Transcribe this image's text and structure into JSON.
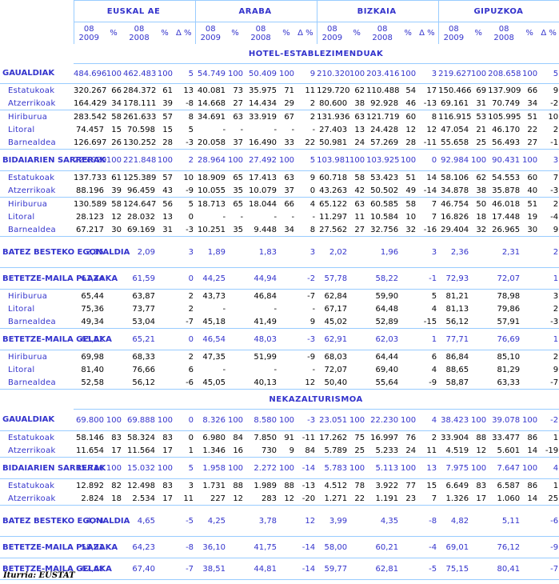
{
  "header": {
    "groups": [
      "EUSKAL AE",
      "ARABA",
      "BIZKAIA",
      "GIPUZKOA"
    ],
    "columns": [
      {
        "line1": "08",
        "line2": "2009"
      },
      {
        "line1": "%",
        "line2": ""
      },
      {
        "line1": "08",
        "line2": "2008"
      },
      {
        "line1": "%",
        "line2": ""
      },
      {
        "line1": "Δ %",
        "line2": ""
      }
    ]
  },
  "sections": [
    {
      "title": "HOTEL-ESTABLEZIMENDUAK",
      "blocks": [
        {
          "rows": [
            {
              "kind": "main",
              "label": "GAUALDIAK",
              "values": [
                "484.696",
                "100",
                "462.483",
                "100",
                "5",
                "54.749",
                "100",
                "50.409",
                "100",
                "9",
                "210.320",
                "100",
                "203.416",
                "100",
                "3",
                "219.627",
                "100",
                "208.658",
                "100",
                "5"
              ]
            }
          ]
        },
        {
          "rows": [
            {
              "kind": "sub",
              "label": "Estatukoak",
              "values": [
                "320.267",
                "66",
                "284.372",
                "61",
                "13",
                "40.081",
                "73",
                "35.975",
                "71",
                "11",
                "129.720",
                "62",
                "110.488",
                "54",
                "17",
                "150.466",
                "69",
                "137.909",
                "66",
                "9"
              ]
            },
            {
              "kind": "sub",
              "label": "Atzerrikoak",
              "values": [
                "164.429",
                "34",
                "178.111",
                "39",
                "-8",
                "14.668",
                "27",
                "14.434",
                "29",
                "2",
                "80.600",
                "38",
                "92.928",
                "46",
                "-13",
                "69.161",
                "31",
                "70.749",
                "34",
                "-2"
              ]
            }
          ]
        },
        {
          "rows": [
            {
              "kind": "sub",
              "label": "Hiriburua",
              "values": [
                "283.542",
                "58",
                "261.633",
                "57",
                "8",
                "34.691",
                "63",
                "33.919",
                "67",
                "2",
                "131.936",
                "63",
                "121.719",
                "60",
                "8",
                "116.915",
                "53",
                "105.995",
                "51",
                "10"
              ]
            },
            {
              "kind": "sub",
              "label": "Litoral",
              "values": [
                "74.457",
                "15",
                "70.598",
                "15",
                "5",
                "-",
                "-",
                "-",
                "-",
                "-",
                "27.403",
                "13",
                "24.428",
                "12",
                "12",
                "47.054",
                "21",
                "46.170",
                "22",
                "2"
              ]
            },
            {
              "kind": "sub",
              "label": "Barnealdea",
              "values": [
                "126.697",
                "26",
                "130.252",
                "28",
                "-3",
                "20.058",
                "37",
                "16.490",
                "33",
                "22",
                "50.981",
                "24",
                "57.269",
                "28",
                "-11",
                "55.658",
                "25",
                "56.493",
                "27",
                "-1"
              ]
            }
          ]
        },
        {
          "rows": [
            {
              "kind": "main two",
              "label": "BIDAIARIEN SARRERAK",
              "values": [
                "225.929",
                "100",
                "221.848",
                "100",
                "2",
                "28.964",
                "100",
                "27.492",
                "100",
                "5",
                "103.981",
                "100",
                "103.925",
                "100",
                "0",
                "92.984",
                "100",
                "90.431",
                "100",
                "3"
              ]
            }
          ]
        },
        {
          "rows": [
            {
              "kind": "sub",
              "label": "Estatukoak",
              "values": [
                "137.733",
                "61",
                "125.389",
                "57",
                "10",
                "18.909",
                "65",
                "17.413",
                "63",
                "9",
                "60.718",
                "58",
                "53.423",
                "51",
                "14",
                "58.106",
                "62",
                "54.553",
                "60",
                "7"
              ]
            },
            {
              "kind": "sub",
              "label": "Atzerrikoak",
              "values": [
                "88.196",
                "39",
                "96.459",
                "43",
                "-9",
                "10.055",
                "35",
                "10.079",
                "37",
                "0",
                "43.263",
                "42",
                "50.502",
                "49",
                "-14",
                "34.878",
                "38",
                "35.878",
                "40",
                "-3"
              ]
            }
          ]
        },
        {
          "rows": [
            {
              "kind": "sub",
              "label": "Hiriburua",
              "values": [
                "130.589",
                "58",
                "124.647",
                "56",
                "5",
                "18.713",
                "65",
                "18.044",
                "66",
                "4",
                "65.122",
                "63",
                "60.585",
                "58",
                "7",
                "46.754",
                "50",
                "46.018",
                "51",
                "2"
              ]
            },
            {
              "kind": "sub",
              "label": "Litoral",
              "values": [
                "28.123",
                "12",
                "28.032",
                "13",
                "0",
                "-",
                "-",
                "-",
                "-",
                "-",
                "11.297",
                "11",
                "10.584",
                "10",
                "7",
                "16.826",
                "18",
                "17.448",
                "19",
                "-4"
              ]
            },
            {
              "kind": "sub",
              "label": "Barnealdea",
              "values": [
                "67.217",
                "30",
                "69.169",
                "31",
                "-3",
                "10.251",
                "35",
                "9.448",
                "34",
                "8",
                "27.562",
                "27",
                "32.756",
                "32",
                "-16",
                "29.404",
                "32",
                "26.965",
                "30",
                "9"
              ]
            }
          ]
        },
        {
          "rows": [
            {
              "kind": "main avg",
              "label": "BATEZ BESTEKO EGONALDIA",
              "values": [
                "2,15",
                "",
                "2,09",
                "",
                "3",
                "1,89",
                "",
                "1,83",
                "",
                "3",
                "2,02",
                "",
                "1,96",
                "",
                "3",
                "2,36",
                "",
                "2,31",
                "",
                "2"
              ]
            }
          ]
        },
        {
          "rows": [
            {
              "kind": "main two",
              "label": "BETETZE-MAILA PLAZAKA",
              "values": [
                "61,44",
                "",
                "61,59",
                "",
                "0",
                "44,25",
                "",
                "44,94",
                "",
                "-2",
                "57,78",
                "",
                "58,22",
                "",
                "-1",
                "72,93",
                "",
                "72,07",
                "",
                "1"
              ]
            }
          ]
        },
        {
          "rows": [
            {
              "kind": "sub",
              "label": "Hiriburua",
              "values": [
                "65,44",
                "",
                "63,87",
                "",
                "2",
                "43,73",
                "",
                "46,84",
                "",
                "-7",
                "62,84",
                "",
                "59,90",
                "",
                "5",
                "81,21",
                "",
                "78,98",
                "",
                "3"
              ]
            },
            {
              "kind": "sub",
              "label": "Litoral",
              "values": [
                "75,36",
                "",
                "73,77",
                "",
                "2",
                "-",
                "",
                "-",
                "",
                "-",
                "67,17",
                "",
                "64,48",
                "",
                "4",
                "81,13",
                "",
                "79,86",
                "",
                "2"
              ]
            },
            {
              "kind": "sub",
              "label": "Barnealdea",
              "values": [
                "49,34",
                "",
                "53,04",
                "",
                "-7",
                "45,18",
                "",
                "41,49",
                "",
                "9",
                "45,02",
                "",
                "52,89",
                "",
                "-15",
                "56,12",
                "",
                "57,91",
                "",
                "-3"
              ]
            }
          ]
        },
        {
          "rows": [
            {
              "kind": "main two",
              "label": "BETETZE-MAILA GELAKA",
              "values": [
                "65,52",
                "",
                "65,21",
                "",
                "0",
                "46,54",
                "",
                "48,03",
                "",
                "-3",
                "62,91",
                "",
                "62,03",
                "",
                "1",
                "77,71",
                "",
                "76,69",
                "",
                "1"
              ]
            }
          ]
        },
        {
          "rows": [
            {
              "kind": "sub",
              "label": "Hiriburua",
              "values": [
                "69,98",
                "",
                "68,33",
                "",
                "2",
                "47,35",
                "",
                "51,99",
                "",
                "-9",
                "68,03",
                "",
                "64,44",
                "",
                "6",
                "86,84",
                "",
                "85,10",
                "",
                "2"
              ]
            },
            {
              "kind": "sub",
              "label": "Litoral",
              "values": [
                "81,40",
                "",
                "76,66",
                "",
                "6",
                "-",
                "",
                "-",
                "",
                "-",
                "72,07",
                "",
                "69,40",
                "",
                "4",
                "88,65",
                "",
                "81,29",
                "",
                "9"
              ]
            },
            {
              "kind": "sub",
              "label": "Barnealdea",
              "values": [
                "52,58",
                "",
                "56,12",
                "",
                "-6",
                "45,05",
                "",
                "40,13",
                "",
                "12",
                "50,40",
                "",
                "55,64",
                "",
                "-9",
                "58,87",
                "",
                "63,33",
                "",
                "-7"
              ]
            }
          ]
        }
      ]
    },
    {
      "title": "NEKAZALTURISMOA",
      "blocks": [
        {
          "rows": [
            {
              "kind": "main two",
              "label": "GAUALDIAK",
              "values": [
                "69.800",
                "100",
                "69.888",
                "100",
                "0",
                "8.326",
                "100",
                "8.580",
                "100",
                "-3",
                "23.051",
                "100",
                "22.230",
                "100",
                "4",
                "38.423",
                "100",
                "39.078",
                "100",
                "-2"
              ]
            }
          ]
        },
        {
          "rows": [
            {
              "kind": "sub",
              "label": "Estatukoak",
              "values": [
                "58.146",
                "83",
                "58.324",
                "83",
                "0",
                "6.980",
                "84",
                "7.850",
                "91",
                "-11",
                "17.262",
                "75",
                "16.997",
                "76",
                "2",
                "33.904",
                "88",
                "33.477",
                "86",
                "1"
              ]
            },
            {
              "kind": "sub",
              "label": "Atzerrikoak",
              "values": [
                "11.654",
                "17",
                "11.564",
                "17",
                "1",
                "1.346",
                "16",
                "730",
                "9",
                "84",
                "5.789",
                "25",
                "5.233",
                "24",
                "11",
                "4.519",
                "12",
                "5.601",
                "14",
                "-19"
              ]
            }
          ]
        },
        {
          "rows": [
            {
              "kind": "main two",
              "label": "BIDAIARIEN SARRERAK",
              "values": [
                "15.716",
                "100",
                "15.032",
                "100",
                "5",
                "1.958",
                "100",
                "2.272",
                "100",
                "-14",
                "5.783",
                "100",
                "5.113",
                "100",
                "13",
                "7.975",
                "100",
                "7.647",
                "100",
                "4"
              ]
            }
          ]
        },
        {
          "rows": [
            {
              "kind": "sub",
              "label": "Estatukoak",
              "values": [
                "12.892",
                "82",
                "12.498",
                "83",
                "3",
                "1.731",
                "88",
                "1.989",
                "88",
                "-13",
                "4.512",
                "78",
                "3.922",
                "77",
                "15",
                "6.649",
                "83",
                "6.587",
                "86",
                "1"
              ]
            },
            {
              "kind": "sub",
              "label": "Atzerrikoak",
              "values": [
                "2.824",
                "18",
                "2.534",
                "17",
                "11",
                "227",
                "12",
                "283",
                "12",
                "-20",
                "1.271",
                "22",
                "1.191",
                "23",
                "7",
                "1.326",
                "17",
                "1.060",
                "14",
                "25"
              ]
            }
          ]
        },
        {
          "rows": [
            {
              "kind": "main avg",
              "label": "BATEZ BESTEKO EGONALDIA",
              "values": [
                "4,44",
                "",
                "4,65",
                "",
                "-5",
                "4,25",
                "",
                "3,78",
                "",
                "12",
                "3,99",
                "",
                "4,35",
                "",
                "-8",
                "4,82",
                "",
                "5,11",
                "",
                "-6"
              ]
            }
          ]
        },
        {
          "rows": [
            {
              "kind": "main two",
              "label": "BETETZE-MAILA PLAZAKA",
              "values": [
                "58,91",
                "",
                "64,23",
                "",
                "-8",
                "36,10",
                "",
                "41,75",
                "",
                "-14",
                "58,00",
                "",
                "60,21",
                "",
                "-4",
                "69,01",
                "",
                "76,12",
                "",
                "-9"
              ]
            }
          ]
        },
        {
          "rows": [
            {
              "kind": "main two",
              "label": "BETETZE-MAILA GELAKA",
              "values": [
                "62,68",
                "",
                "67,40",
                "",
                "-7",
                "38,51",
                "",
                "44,81",
                "",
                "-14",
                "59,77",
                "",
                "62,81",
                "",
                "-5",
                "75,15",
                "",
                "80,41",
                "",
                "-7"
              ]
            }
          ]
        }
      ]
    }
  ],
  "source": "Iturria: EUSTAT",
  "colors": {
    "accent_text": "#3333cc",
    "rule_lines": "#99ccff"
  }
}
